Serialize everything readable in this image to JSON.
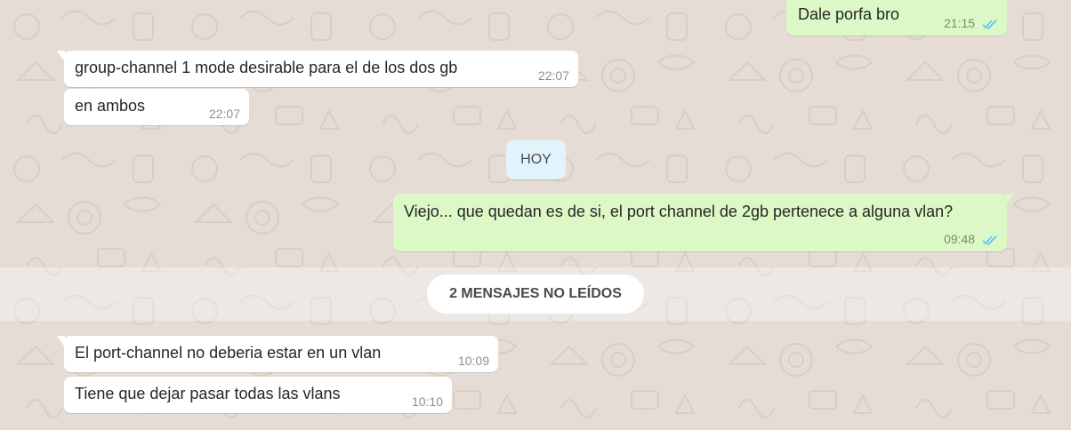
{
  "colors": {
    "background": "#e5ddd5",
    "incoming_bubble": "#ffffff",
    "outgoing_bubble": "#dcf8c6",
    "read_ticks": "#4fc3f7",
    "day_chip": "#e1f3fb"
  },
  "messages": [
    {
      "direction": "out",
      "text": "Dale porfa bro",
      "time": "21:15",
      "status": "read"
    },
    {
      "direction": "in",
      "text": "group-channel 1 mode desirable para el de los dos gb",
      "time": "22:07"
    },
    {
      "direction": "in",
      "text": "en ambos",
      "time": "22:07"
    },
    {
      "direction": "out",
      "text": "Viejo... que quedan es de si, el port channel de 2gb pertenece a alguna vlan?",
      "time": "09:48",
      "status": "read"
    },
    {
      "direction": "in",
      "text": "El port-channel no deberia estar en un vlan",
      "time": "10:09"
    },
    {
      "direction": "in",
      "text": "Tiene que dejar pasar todas las vlans",
      "time": "10:10"
    }
  ],
  "day_divider": {
    "label": "HOY"
  },
  "unread_divider": {
    "label": "2 MENSAJES NO LEÍDOS"
  },
  "icons": {
    "tail": "bubble-tail",
    "read_receipt": "double-check-icon"
  }
}
